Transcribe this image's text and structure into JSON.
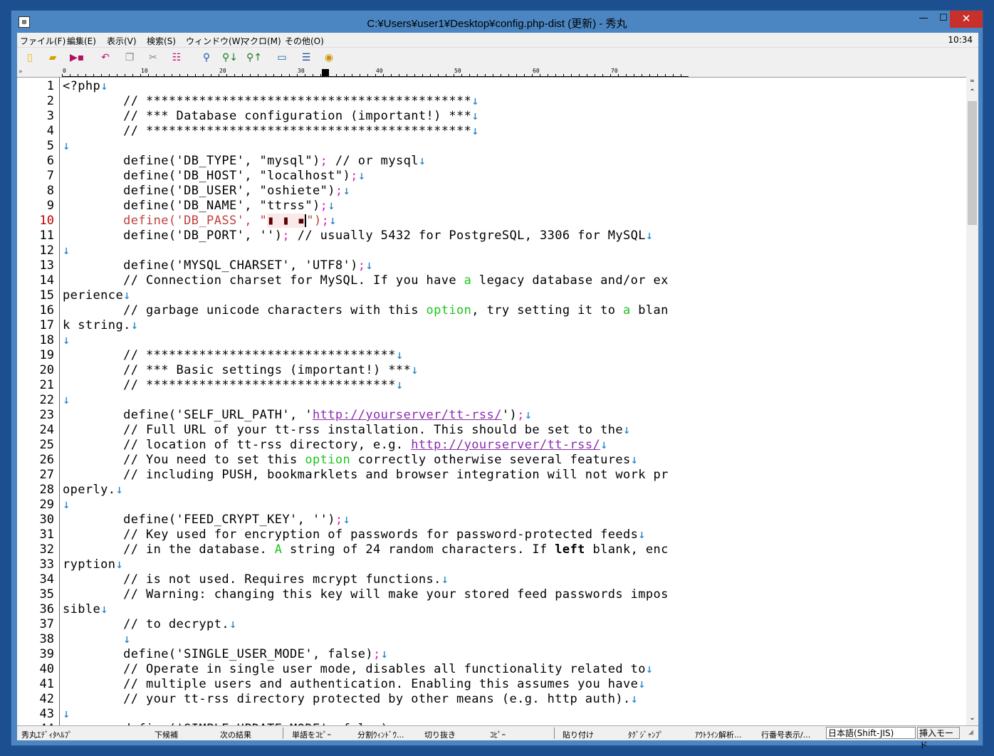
{
  "window": {
    "title": "C:¥Users¥user1¥Desktop¥config.php-dist (更新) - 秀丸",
    "minimize": "—",
    "maximize": "☐",
    "close": "✕"
  },
  "menu": {
    "items": [
      "ファイル(F)",
      "編集(E)",
      "表示(V)",
      "検索(S)",
      "ウィンドウ(W)",
      "マクロ(M)",
      "その他(O)"
    ],
    "clock": "10:34"
  },
  "toolbar": {
    "icons": [
      "new-file-icon",
      "open-folder-icon",
      "save-icon",
      "undo-icon",
      "copy-icon",
      "cut-icon",
      "paste-icon",
      "search-icon",
      "search-next-icon",
      "search-prev-icon",
      "window-icon",
      "split-icon",
      "help-icon"
    ]
  },
  "ruler": {
    "left_mark": "»",
    "labels": [
      "0",
      "10",
      "20",
      "30",
      "40",
      "50",
      "60",
      "70"
    ]
  },
  "editor": {
    "current_line": 10,
    "lines": [
      {
        "n": "1",
        "segs": [
          [
            "<?php",
            ""
          ],
          [
            "↓",
            "nl"
          ]
        ]
      },
      {
        "n": "2",
        "segs": [
          [
            "        // *******************************************",
            ""
          ],
          [
            "↓",
            "nl"
          ]
        ]
      },
      {
        "n": "3",
        "segs": [
          [
            "        // *** Database configuration (important!) ***",
            ""
          ],
          [
            "↓",
            "nl"
          ]
        ]
      },
      {
        "n": "4",
        "segs": [
          [
            "        // *******************************************",
            ""
          ],
          [
            "↓",
            "nl"
          ]
        ]
      },
      {
        "n": "5",
        "segs": [
          [
            "↓",
            "nl"
          ]
        ]
      },
      {
        "n": "6",
        "segs": [
          [
            "        define('DB_TYPE', \"mysql\")",
            ""
          ],
          [
            ";",
            "sep"
          ],
          [
            " // or mysql",
            ""
          ],
          [
            "↓",
            "nl"
          ]
        ]
      },
      {
        "n": "7",
        "segs": [
          [
            "        define('DB_HOST', \"localhost\")",
            ""
          ],
          [
            ";",
            "sep"
          ],
          [
            "↓",
            "nl"
          ]
        ]
      },
      {
        "n": "8",
        "segs": [
          [
            "        define('DB_USER', \"oshiete\")",
            ""
          ],
          [
            ";",
            "sep"
          ],
          [
            "↓",
            "nl"
          ]
        ]
      },
      {
        "n": "9",
        "segs": [
          [
            "        define('DB_NAME', \"ttrss\")",
            ""
          ],
          [
            ";",
            "sep"
          ],
          [
            "↓",
            "nl"
          ]
        ]
      },
      {
        "n": "10",
        "segs": [
          [
            "        define('DB_PASS', \"",
            "cur-line"
          ],
          [
            "▮ ▮ ▪",
            "redacted"
          ],
          [
            "CARET",
            "caret"
          ],
          [
            "\")",
            "cur-line"
          ],
          [
            ";",
            "sep"
          ],
          [
            "↓",
            "nl"
          ]
        ]
      },
      {
        "n": "11",
        "segs": [
          [
            "        define('DB_PORT', '')",
            ""
          ],
          [
            ";",
            "sep"
          ],
          [
            " // usually 5432 for PostgreSQL, 3306 for MySQL",
            ""
          ],
          [
            "↓",
            "nl"
          ]
        ]
      },
      {
        "n": "12",
        "segs": [
          [
            "↓",
            "nl"
          ]
        ]
      },
      {
        "n": "13",
        "segs": [
          [
            "        define('MYSQL_CHARSET', 'UTF8')",
            ""
          ],
          [
            ";",
            "sep"
          ],
          [
            "↓",
            "nl"
          ]
        ]
      },
      {
        "n": "14",
        "segs": [
          [
            "        // Connection charset for MySQL. If you have ",
            ""
          ],
          [
            "a",
            "kw"
          ],
          [
            " legacy database and/or ex",
            ""
          ]
        ]
      },
      {
        "n": "15",
        "segs": [
          [
            "perience",
            ""
          ],
          [
            "↓",
            "nl"
          ]
        ]
      },
      {
        "n": "16",
        "segs": [
          [
            "        // garbage unicode characters with this ",
            ""
          ],
          [
            "option",
            "kw"
          ],
          [
            ", try setting it to ",
            ""
          ],
          [
            "a",
            "kw"
          ],
          [
            " blan",
            ""
          ]
        ]
      },
      {
        "n": "17",
        "segs": [
          [
            "k string.",
            ""
          ],
          [
            "↓",
            "nl"
          ]
        ]
      },
      {
        "n": "18",
        "segs": [
          [
            "↓",
            "nl"
          ]
        ]
      },
      {
        "n": "19",
        "segs": [
          [
            "        // *********************************",
            ""
          ],
          [
            "↓",
            "nl"
          ]
        ]
      },
      {
        "n": "20",
        "segs": [
          [
            "        // *** Basic settings (important!) ***",
            ""
          ],
          [
            "↓",
            "nl"
          ]
        ]
      },
      {
        "n": "21",
        "segs": [
          [
            "        // *********************************",
            ""
          ],
          [
            "↓",
            "nl"
          ]
        ]
      },
      {
        "n": "22",
        "segs": [
          [
            "↓",
            "nl"
          ]
        ]
      },
      {
        "n": "23",
        "segs": [
          [
            "        define('SELF_URL_PATH', '",
            ""
          ],
          [
            "http://yourserver/tt-rss/",
            "url"
          ],
          [
            "')",
            ""
          ],
          [
            ";",
            "sep"
          ],
          [
            "↓",
            "nl"
          ]
        ]
      },
      {
        "n": "24",
        "segs": [
          [
            "        // Full URL of your tt-rss installation. This should be set to the",
            ""
          ],
          [
            "↓",
            "nl"
          ]
        ]
      },
      {
        "n": "25",
        "segs": [
          [
            "        // location of tt-rss directory, e.g. ",
            ""
          ],
          [
            "http://yourserver/tt-rss/",
            "url"
          ],
          [
            "↓",
            "nl"
          ]
        ]
      },
      {
        "n": "26",
        "segs": [
          [
            "        // You need to set this ",
            ""
          ],
          [
            "option",
            "kw"
          ],
          [
            " correctly otherwise several features",
            ""
          ],
          [
            "↓",
            "nl"
          ]
        ]
      },
      {
        "n": "27",
        "segs": [
          [
            "        // including PUSH, bookmarklets and browser integration will not work pr",
            ""
          ]
        ]
      },
      {
        "n": "28",
        "segs": [
          [
            "operly.",
            ""
          ],
          [
            "↓",
            "nl"
          ]
        ]
      },
      {
        "n": "29",
        "segs": [
          [
            "↓",
            "nl"
          ]
        ]
      },
      {
        "n": "30",
        "segs": [
          [
            "        define('FEED_CRYPT_KEY', '')",
            ""
          ],
          [
            ";",
            "sep"
          ],
          [
            "↓",
            "nl"
          ]
        ]
      },
      {
        "n": "31",
        "segs": [
          [
            "        // Key used for encryption of passwords for password-protected feeds",
            ""
          ],
          [
            "↓",
            "nl"
          ]
        ]
      },
      {
        "n": "32",
        "segs": [
          [
            "        // in the database. ",
            ""
          ],
          [
            "A",
            "kw"
          ],
          [
            " string of 24 random characters. If ",
            ""
          ],
          [
            "left",
            "bold"
          ],
          [
            " blank, enc",
            ""
          ]
        ]
      },
      {
        "n": "33",
        "segs": [
          [
            "ryption",
            ""
          ],
          [
            "↓",
            "nl"
          ]
        ]
      },
      {
        "n": "34",
        "segs": [
          [
            "        // is not used. Requires mcrypt functions.",
            ""
          ],
          [
            "↓",
            "nl"
          ]
        ]
      },
      {
        "n": "35",
        "segs": [
          [
            "        // Warning: changing this key will make your stored feed passwords impos",
            ""
          ]
        ]
      },
      {
        "n": "36",
        "segs": [
          [
            "sible",
            ""
          ],
          [
            "↓",
            "nl"
          ]
        ]
      },
      {
        "n": "37",
        "segs": [
          [
            "        // to decrypt.",
            ""
          ],
          [
            "↓",
            "nl"
          ]
        ]
      },
      {
        "n": "38",
        "segs": [
          [
            "        ",
            ""
          ],
          [
            "↓",
            "nl"
          ]
        ]
      },
      {
        "n": "39",
        "segs": [
          [
            "        define('SINGLE_USER_MODE', false)",
            ""
          ],
          [
            ";",
            "sep"
          ],
          [
            "↓",
            "nl"
          ]
        ]
      },
      {
        "n": "40",
        "segs": [
          [
            "        // Operate in single user mode, disables all functionality related to",
            ""
          ],
          [
            "↓",
            "nl"
          ]
        ]
      },
      {
        "n": "41",
        "segs": [
          [
            "        // multiple users and authentication. Enabling this assumes you have",
            ""
          ],
          [
            "↓",
            "nl"
          ]
        ]
      },
      {
        "n": "42",
        "segs": [
          [
            "        // your tt-rss directory protected by other means (e.g. http auth).",
            ""
          ],
          [
            "↓",
            "nl"
          ]
        ]
      },
      {
        "n": "43",
        "segs": [
          [
            "↓",
            "nl"
          ]
        ]
      },
      {
        "n": "44",
        "segs": [
          [
            "        define('SIMPLE_UPDATE_MODE', false)",
            ""
          ],
          [
            ";",
            "sep"
          ],
          [
            "↓",
            "nl"
          ]
        ]
      }
    ]
  },
  "statusbar": {
    "fkeys": [
      "秀丸ｴﾃﾞｨﾀﾍﾙﾌﾟ",
      "下候補",
      "次の結果",
      "単語をｺﾋﾟｰ",
      "分割ｳｨﾝﾄﾞｳ...",
      "切り抜き",
      "ｺﾋﾟｰ",
      "貼り付け",
      "ﾀｸﾞｼﾞｬﾝﾌﾟ",
      "ｱｳﾄﾗｲﾝ解析...",
      "行番号表示/..."
    ],
    "encoding": "日本語(Shift-JIS)",
    "mode": "挿入モード"
  }
}
